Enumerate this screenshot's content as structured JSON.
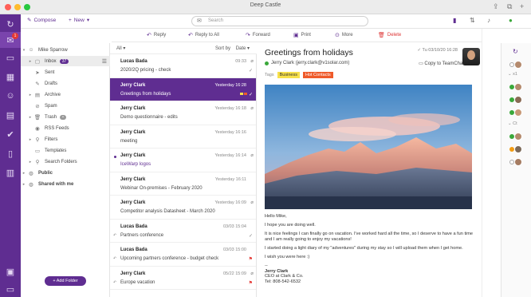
{
  "window": {
    "title": "Deep Castle"
  },
  "rail": {
    "items": [
      {
        "name": "logo-icon",
        "glyph": "↻"
      },
      {
        "name": "mail-icon",
        "glyph": "✉",
        "badge": "1"
      },
      {
        "name": "chat-icon",
        "glyph": "▭"
      },
      {
        "name": "calendar-icon",
        "glyph": "▦"
      },
      {
        "name": "contacts-icon",
        "glyph": "☺"
      },
      {
        "name": "files-icon",
        "glyph": "▤"
      },
      {
        "name": "tasks-icon",
        "glyph": "✔"
      },
      {
        "name": "notes-icon",
        "glyph": "▯"
      },
      {
        "name": "documents-icon",
        "glyph": "▥"
      }
    ]
  },
  "toolbar": {
    "compose_label": "Compose",
    "new_label": "New",
    "search_placeholder": "Search"
  },
  "actions": {
    "reply": "Reply",
    "reply_all": "Reply to All",
    "forward": "Forward",
    "print": "Print",
    "more": "More",
    "delete": "Delete"
  },
  "folders": {
    "account": "Mike Sparrow",
    "items": [
      {
        "label": "Inbox",
        "count": "37",
        "icon": "▢"
      },
      {
        "label": "Sent",
        "icon": "➤"
      },
      {
        "label": "Drafts",
        "icon": "✎"
      },
      {
        "label": "Archive",
        "icon": "▤"
      },
      {
        "label": "Spam",
        "icon": "⊘"
      },
      {
        "label": "Trash",
        "count": "•",
        "icon": "🗑"
      },
      {
        "label": "RSS Feeds",
        "icon": "◉"
      },
      {
        "label": "Filters",
        "icon": "⚲"
      },
      {
        "label": "Templates",
        "icon": "▭"
      },
      {
        "label": "Search Folders",
        "icon": "⚲"
      }
    ],
    "public": "Public",
    "shared": "Shared with me",
    "add_folder": "Add Folder"
  },
  "list": {
    "filter": "All",
    "sort_label": "Sort by",
    "sort_value": "Date",
    "messages": [
      {
        "sender": "Lucas Bada",
        "subject": "2020/2Q pricing - check",
        "date": "09:33"
      },
      {
        "sender": "Jerry Clark",
        "subject": "Greetings from holidays",
        "date": "Yesterday 16:28"
      },
      {
        "sender": "Jerry Clark",
        "subject": "Demo questionnaire - edits",
        "date": "Yesterday 16:18"
      },
      {
        "sender": "Jerry Clark",
        "subject": "meeting",
        "date": "Yesterday 16:16"
      },
      {
        "sender": "Jerry Clark",
        "subject": "IceWarp logos",
        "date": "Yesterday 16:14"
      },
      {
        "sender": "Jerry Clark",
        "subject": "Webinar On-premises - February 2020",
        "date": "Yesterday 16:11"
      },
      {
        "sender": "Jerry Clark",
        "subject": "Competitor analysis Datasheet - March 2020",
        "date": "Yesterday 16:09"
      },
      {
        "sender": "Lucas Bada",
        "subject": "Partners conference",
        "date": "03/03 15:04"
      },
      {
        "sender": "Lucas Bada",
        "subject": "Upcoming partners conference - budget check",
        "date": "03/03 15:00"
      },
      {
        "sender": "Jerry Clark",
        "subject": "Europe vacation",
        "date": "05/22 15:09"
      }
    ]
  },
  "reader": {
    "subject": "Greetings from holidays",
    "date": "Tu 03/10/20 16:28",
    "from": "Jerry Clark (jerry.clark@v1solar.com)",
    "copy_to": "Copy to TeamChat",
    "tags_label": "Tags",
    "tags": [
      "Business",
      "Hot Contacts"
    ],
    "tag_colors": [
      "#f7e04a",
      "#ef5a2a"
    ],
    "body": [
      "Hello Mike,",
      "I hope you are doing well.",
      "It is nice feelings I can finally go on vacation. I've worked hard all the time, so I deserve to have a fun time and I am really going to enjoy my vacations!",
      "I started doing a light diary of my \"adventures\" during my stay so I will upload them when I get home.",
      "I wish you were here :)"
    ],
    "signature": [
      "--",
      "Jerry Clark",
      "CEO at Clark & Co.",
      "Tel: 808-542-6532"
    ]
  },
  "contacts": {
    "groups": [
      "x1",
      "Ct"
    ]
  },
  "colors": {
    "brand": "#5f2d91",
    "unread": "#5f2d91"
  }
}
